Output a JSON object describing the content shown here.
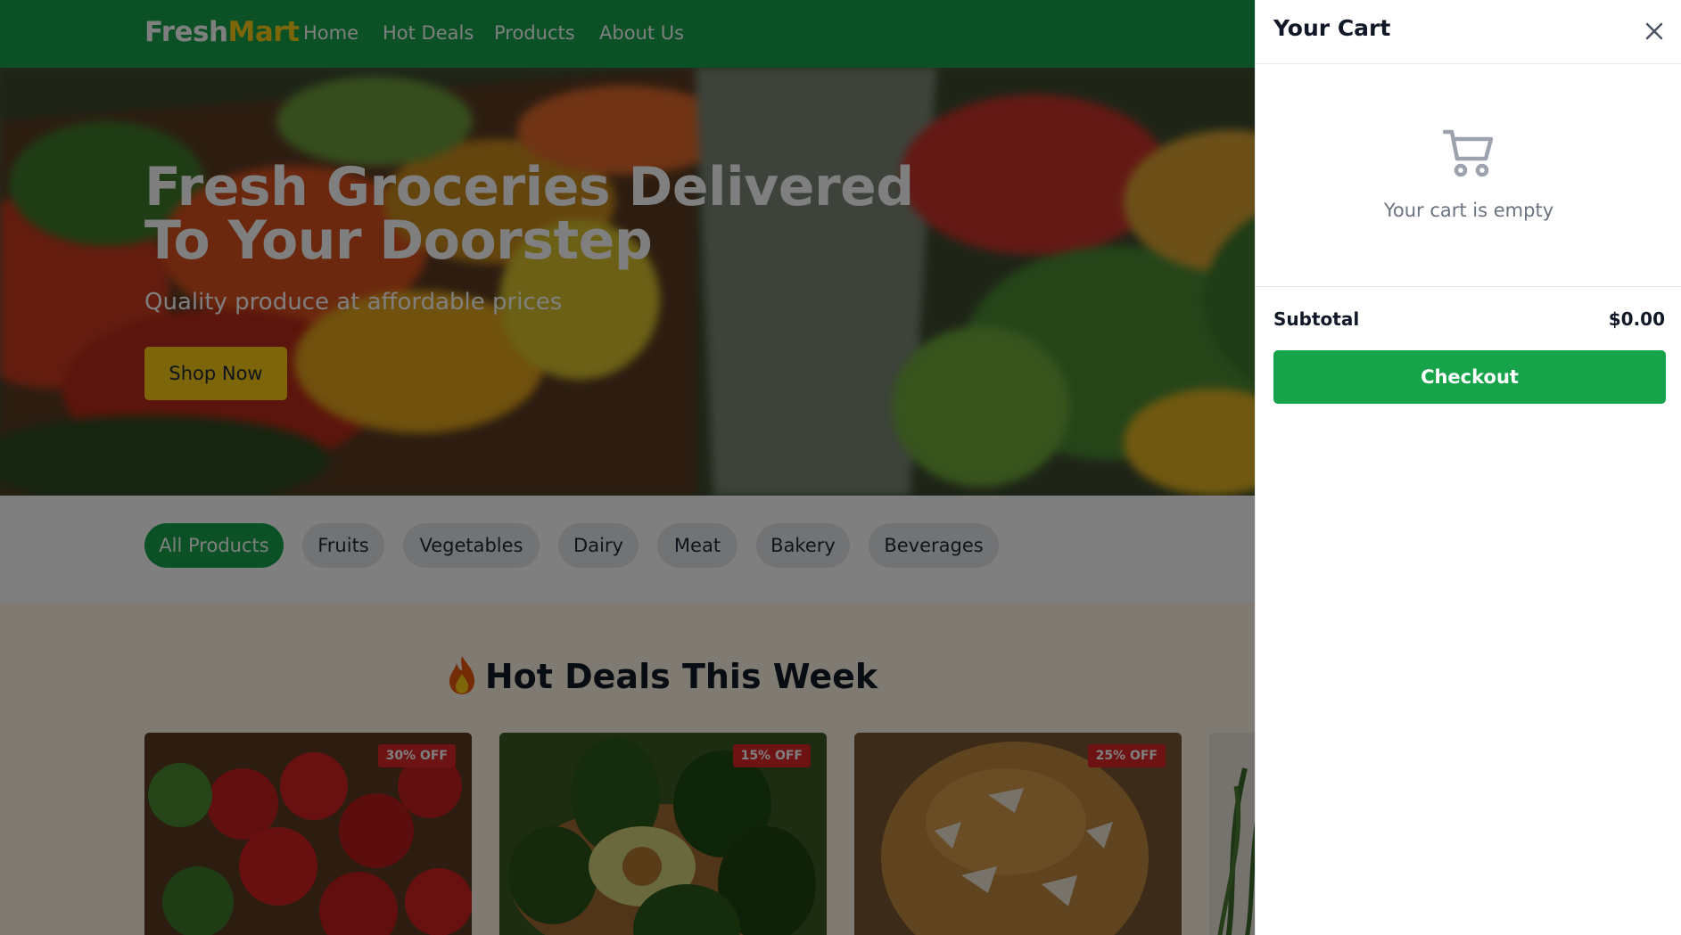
{
  "colors": {
    "brand_green": "#16a34a",
    "accent_yellow": "#facc15",
    "sale_red": "#dc2626"
  },
  "navbar": {
    "logo_part1": "Fresh",
    "logo_part2": "Mart",
    "links": [
      "Home",
      "Hot Deals",
      "Products",
      "About Us"
    ]
  },
  "hero": {
    "title": "Fresh Groceries Delivered To Your Doorstep",
    "subtitle": "Quality produce at affordable prices",
    "cta_label": "Shop Now"
  },
  "filters": {
    "active": "All Products",
    "items": [
      "All Products",
      "Fruits",
      "Vegetables",
      "Dairy",
      "Meat",
      "Bakery",
      "Beverages"
    ]
  },
  "deals": {
    "icon": "fire-icon",
    "title": "Hot Deals This Week",
    "cards": [
      {
        "product_icon": "strawberries-image",
        "badge": "30% OFF"
      },
      {
        "product_icon": "avocados-image",
        "badge": "15% OFF"
      },
      {
        "product_icon": "bread-image",
        "badge": "25% OFF"
      },
      {
        "product_icon": "herbs-image"
      }
    ]
  },
  "cart": {
    "title": "Your Cart",
    "close_icon": "close-icon",
    "cart_icon": "cart-icon",
    "empty_text": "Your cart is empty",
    "subtotal_label": "Subtotal",
    "subtotal_value": "$0.00",
    "checkout_label": "Checkout"
  }
}
